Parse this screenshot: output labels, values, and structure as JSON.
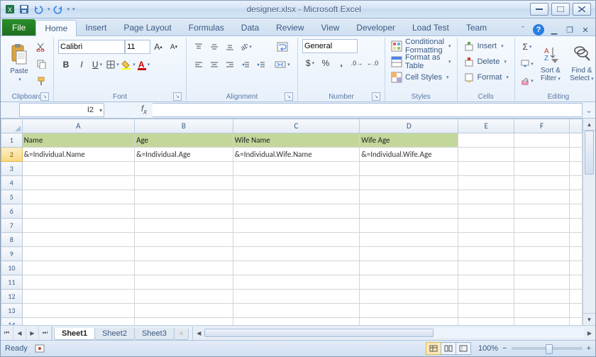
{
  "title": "designer.xlsx - Microsoft Excel",
  "qat": {
    "save": "save",
    "undo": "undo",
    "redo": "redo"
  },
  "tabs": {
    "file": "File",
    "home": "Home",
    "insert": "Insert",
    "pagelayout": "Page Layout",
    "formulas": "Formulas",
    "data": "Data",
    "review": "Review",
    "view": "View",
    "developer": "Developer",
    "loadtest": "Load Test",
    "team": "Team"
  },
  "ribbon": {
    "clipboard": {
      "label": "Clipboard",
      "paste": "Paste"
    },
    "font": {
      "label": "Font",
      "name": "Calibri",
      "size": "11"
    },
    "alignment": {
      "label": "Alignment"
    },
    "number": {
      "label": "Number",
      "format": "General"
    },
    "styles": {
      "label": "Styles",
      "condfmt": "Conditional Formatting",
      "fmttable": "Format as Table",
      "cellstyles": "Cell Styles"
    },
    "cells": {
      "label": "Cells",
      "insert": "Insert",
      "delete": "Delete",
      "format": "Format"
    },
    "editing": {
      "label": "Editing",
      "sort": "Sort & Filter",
      "find": "Find & Select"
    }
  },
  "namebox": "I2",
  "columns": [
    "A",
    "B",
    "C",
    "D",
    "E",
    "F"
  ],
  "headers": {
    "a": "Name",
    "b": "Age",
    "c": "Wife Name",
    "d": "Wife Age"
  },
  "cells": {
    "a2": "&=Individual.Name",
    "b2": "&=Individual.Age",
    "c2": "&=Individual.Wife.Name",
    "d2": "&=Individual.Wife.Age"
  },
  "sheets": {
    "s1": "Sheet1",
    "s2": "Sheet2",
    "s3": "Sheet3"
  },
  "status": {
    "ready": "Ready",
    "zoom": "100%"
  },
  "icons": {
    "sigma": "Σ",
    "fill": "▣",
    "clear": "◇"
  }
}
